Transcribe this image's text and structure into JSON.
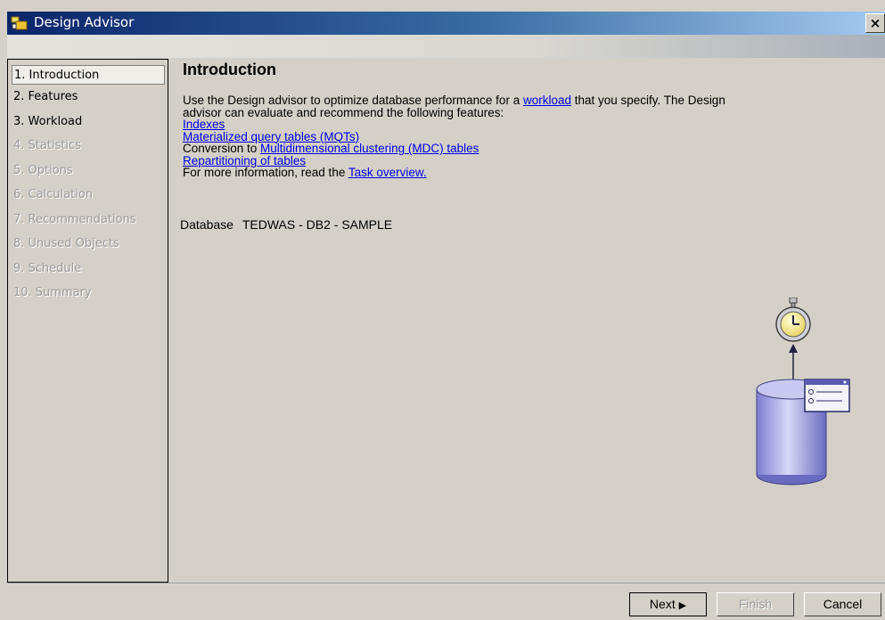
{
  "window": {
    "title": "Design Advisor",
    "close_glyph": "×",
    "app_icon": "design-advisor-icon",
    "title_gradient": [
      "#0a246a",
      "#a6caf0"
    ]
  },
  "nav": {
    "items": [
      {
        "label": "1. Introduction",
        "state": "selected"
      },
      {
        "label": "2. Features",
        "state": "enabled"
      },
      {
        "label": "3. Workload",
        "state": "enabled"
      },
      {
        "label": "4. Statistics",
        "state": "disabled"
      },
      {
        "label": "5. Options",
        "state": "disabled"
      },
      {
        "label": "6. Calculation",
        "state": "disabled"
      },
      {
        "label": "7. Recommendations",
        "state": "disabled"
      },
      {
        "label": "8. Unused Objects",
        "state": "disabled"
      },
      {
        "label": "9. Schedule",
        "state": "disabled"
      },
      {
        "label": "10. Summary",
        "state": "disabled"
      }
    ]
  },
  "main": {
    "heading": "Introduction",
    "intro_text_1": "Use the Design advisor to optimize database performance for a ",
    "workload_link": "workload",
    "intro_text_2": " that you specify. The Design",
    "intro_text_3": "advisor can evaluate and recommend the following features:",
    "links": {
      "indexes": "Indexes",
      "mqt": "Materialized query tables (MQTs)",
      "conversion_prefix": "Conversion to ",
      "mdc": "Multidimensional clustering (MDC) tables",
      "repartitioning": "Repartitioning of tables"
    },
    "more_info_prefix": "For more information, read the ",
    "task_overview_link": "Task overview.",
    "database_label": "Database",
    "database_value": "TEDWAS - DB2 - SAMPLE",
    "illustration": "stopwatch-database-icon"
  },
  "buttons": {
    "next": "Next",
    "next_arrow": "▶",
    "finish": "Finish",
    "cancel": "Cancel"
  },
  "colors": {
    "link": "#0000ee",
    "disabled_text": "#9b9b9b",
    "background": "#d4d0c8"
  }
}
